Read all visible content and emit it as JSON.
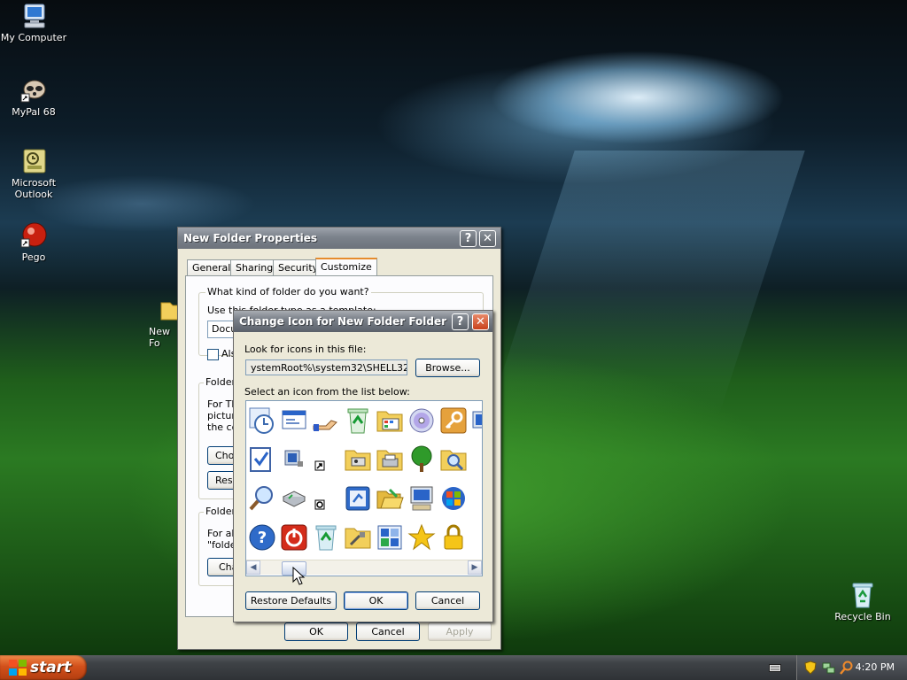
{
  "desktop": {
    "icons": [
      {
        "label": "My Computer"
      },
      {
        "label": "MyPal 68"
      },
      {
        "label": "Microsoft Outlook"
      },
      {
        "label": "Pego"
      },
      {
        "label": "New Fo"
      },
      {
        "label": "Recycle Bin"
      }
    ]
  },
  "properties_window": {
    "title": "New Folder Properties",
    "help_glyph": "?",
    "close_glyph": "✕",
    "tabs": [
      {
        "label": "General"
      },
      {
        "label": "Sharing"
      },
      {
        "label": "Security"
      },
      {
        "label": "Customize",
        "selected": true
      }
    ],
    "question": "What kind of folder do you want?",
    "use_template_label": "Use this folder type as a template:",
    "template_value": "Docu",
    "also_apply_label": "Also",
    "folder_pictures_group": "Folder",
    "folder_pictures_text": [
      "For Th",
      "picture",
      "the co"
    ],
    "choose_picture_button": "Cho",
    "restore_button": "Res",
    "folder_icons_group": "Folder",
    "folder_icons_text": [
      "For all",
      "\"folde"
    ],
    "change_icon_button": "Cha",
    "ok": "OK",
    "cancel": "Cancel",
    "apply": "Apply"
  },
  "change_icon_dialog": {
    "title": "Change Icon for New Folder Folder",
    "help_glyph": "?",
    "close_glyph": "✕",
    "look_for_label": "Look for icons in this file:",
    "file_path": "ystemRoot%\\system32\\SHELL32.dll",
    "browse_button": "Browse...",
    "select_label": "Select an icon from the list below:",
    "restore_defaults_button": "Restore Defaults",
    "ok_button": "OK",
    "cancel_button": "Cancel",
    "scroll_left": "◀",
    "scroll_right": "▶",
    "icons": [
      "clock-icon",
      "window-icon",
      "hand-icon",
      "recycle-full-icon",
      "control-panel-icon",
      "cd-icon",
      "key-icon",
      "monitor-icon",
      "checklist-icon",
      "network-icon",
      "shortcut-arrow-icon",
      "folder-settings-icon",
      "folder-printer-icon",
      "tree-icon",
      "search-folder-icon",
      "magnifier-icon",
      "network-drive-icon",
      "cd-small-icon",
      "window-refresh-icon",
      "folder-open-icon",
      "computer-icon",
      "windows-logo-icon",
      "help-icon",
      "power-icon",
      "recycle-empty-icon",
      "folder-tools-icon",
      "window-tiles-icon",
      "star-icon",
      "lock-icon"
    ]
  },
  "taskbar": {
    "start_label": "start",
    "clock": "4:20 PM"
  }
}
